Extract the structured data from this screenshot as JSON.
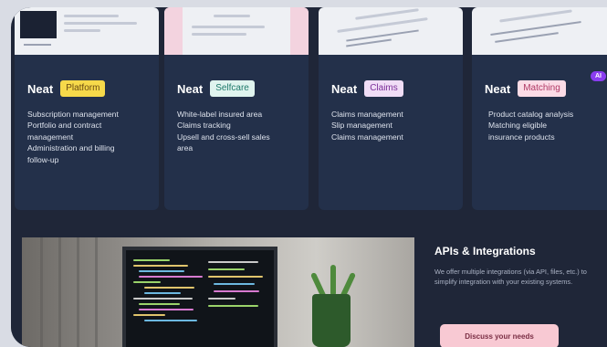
{
  "cards": [
    {
      "neat": "Neat",
      "badge": "Platform",
      "features": [
        "Subscription management",
        "Portfolio and contract",
        "management",
        "Administration and billing",
        "follow-up"
      ]
    },
    {
      "neat": "Neat",
      "badge": "Selfcare",
      "features": [
        "White-label insured area",
        "Claims tracking",
        "Upsell and cross-sell sales",
        "area"
      ]
    },
    {
      "neat": "Neat",
      "badge": "Claims",
      "features": [
        "Claims management",
        "Slip management",
        "Claims management"
      ]
    },
    {
      "neat": "Neat",
      "badge": "Matching",
      "ai_badge": "AI",
      "features": [
        "Product catalog analysis",
        "Matching eligible",
        "insurance products"
      ]
    }
  ],
  "integrations": {
    "title": "APIs & Integrations",
    "description": "We offer multiple integrations (via API, files, etc.) to simplify integration with your existing systems.",
    "cta": "Discuss your needs"
  },
  "colors": {
    "background": "#1f2638",
    "card": "#23304a",
    "platform_badge": "#f6d94a",
    "selfcare_badge": "#dff3ee",
    "claims_badge": "#f0ddf6",
    "matching_badge": "#fbdbe6",
    "ai_badge": "#8a3df0",
    "cta": "#f8c9d3"
  }
}
